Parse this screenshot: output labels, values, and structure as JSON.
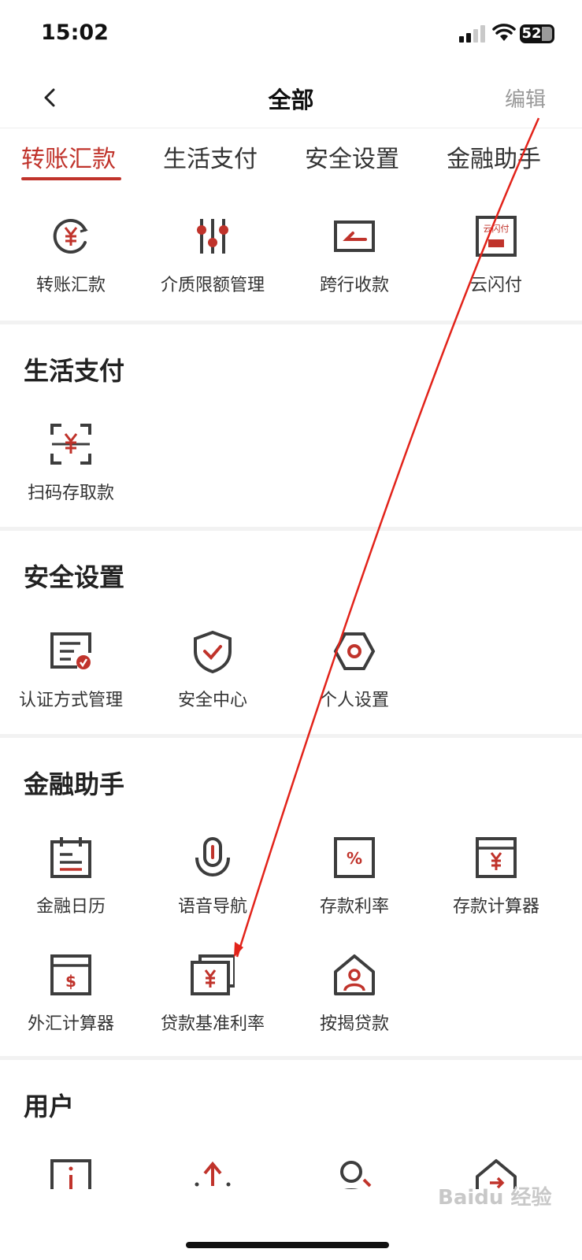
{
  "status": {
    "time": "15:02",
    "battery": "52"
  },
  "nav": {
    "title": "全部",
    "edit_label": "编辑"
  },
  "tabs": [
    "转账汇款",
    "生活支付",
    "安全设置",
    "金融助手"
  ],
  "transfer": {
    "items": [
      {
        "label": "转账汇款",
        "icon": "yuan-circle-icon"
      },
      {
        "label": "介质限额管理",
        "icon": "sliders-icon"
      },
      {
        "label": "跨行收款",
        "icon": "receive-icon"
      },
      {
        "label": "云闪付",
        "icon": "quickpass-icon",
        "icon_text": "云闪付"
      }
    ]
  },
  "life": {
    "title": "生活支付",
    "items": [
      {
        "label": "扫码存取款",
        "icon": "scan-yuan-icon"
      }
    ]
  },
  "security": {
    "title": "安全设置",
    "items": [
      {
        "label": "认证方式管理",
        "icon": "certificate-icon"
      },
      {
        "label": "安全中心",
        "icon": "shield-check-icon"
      },
      {
        "label": "个人设置",
        "icon": "hexagon-settings-icon"
      }
    ]
  },
  "finance": {
    "title": "金融助手",
    "items": [
      {
        "label": "金融日历",
        "icon": "calendar-icon"
      },
      {
        "label": "语音导航",
        "icon": "microphone-icon"
      },
      {
        "label": "存款利率",
        "icon": "percent-icon"
      },
      {
        "label": "存款计算器",
        "icon": "yuan-calculator-icon"
      },
      {
        "label": "外汇计算器",
        "icon": "dollar-calculator-icon"
      },
      {
        "label": "贷款基准利率",
        "icon": "stacked-yuan-icon"
      },
      {
        "label": "按揭贷款",
        "icon": "house-person-icon"
      }
    ]
  },
  "user": {
    "title": "用户",
    "items": [
      {
        "icon": "info-doc-icon"
      },
      {
        "icon": "upload-icon"
      },
      {
        "icon": "user-search-icon"
      },
      {
        "icon": "house-arrow-icon"
      }
    ]
  },
  "colors": {
    "accent": "#c0332b",
    "icon_gray": "#3d3d3d",
    "arrow": "#e2231a"
  }
}
